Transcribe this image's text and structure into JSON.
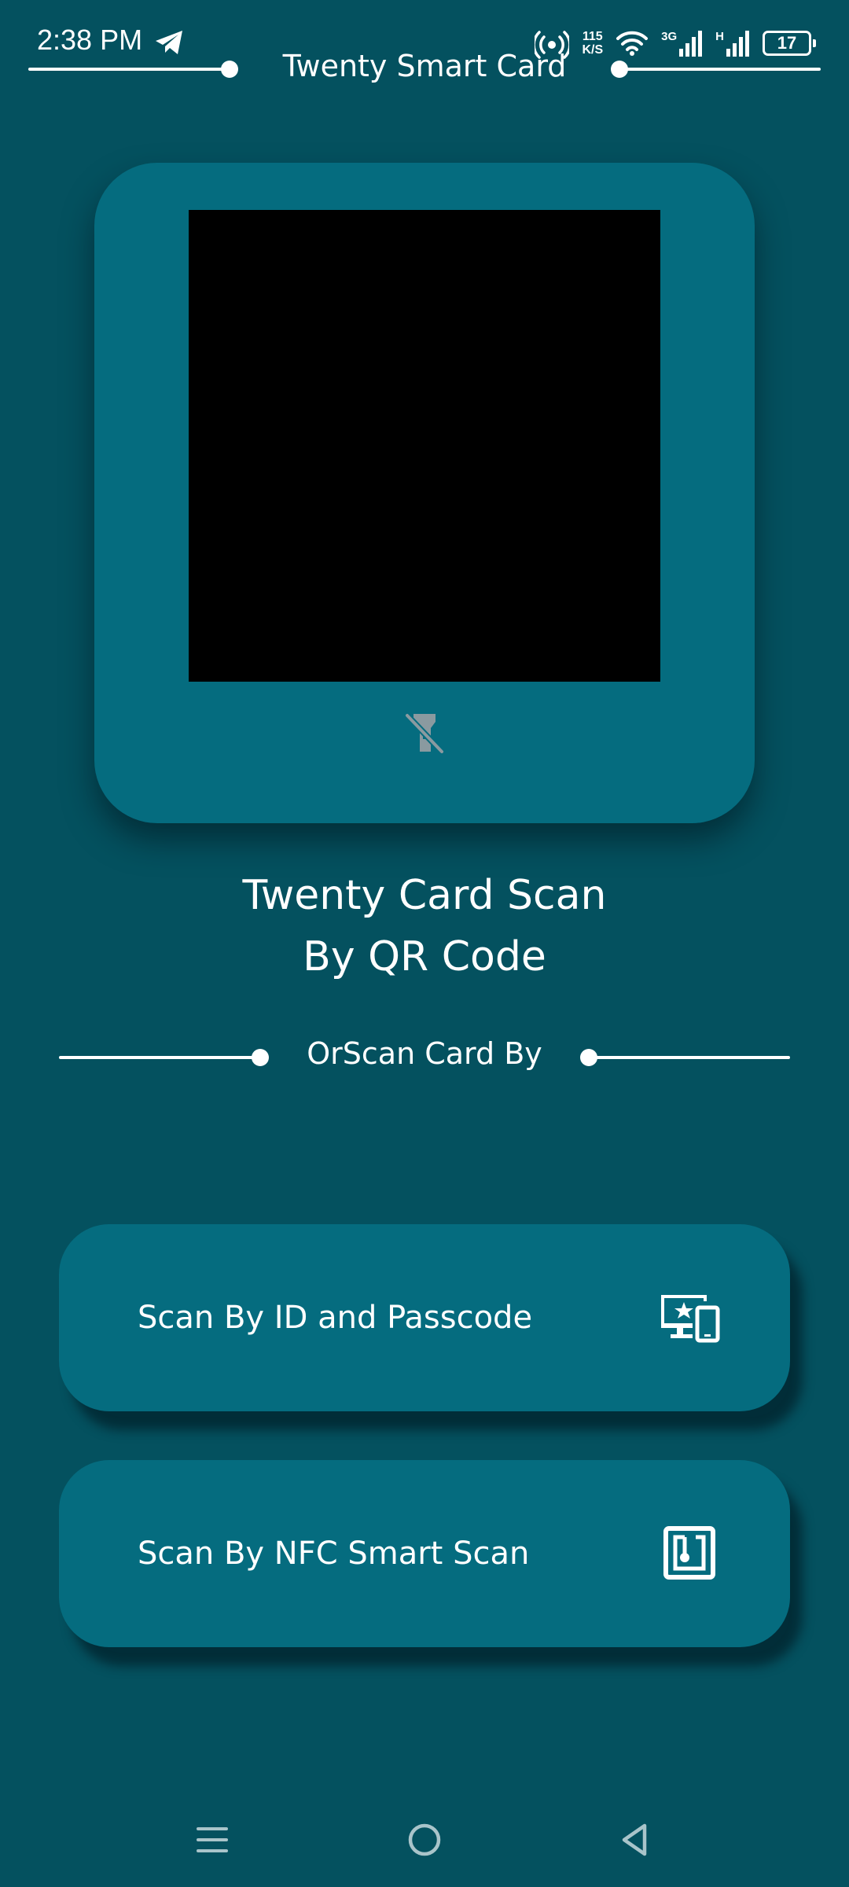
{
  "status_bar": {
    "time": "2:38 PM",
    "net_speed_value": "115",
    "net_speed_unit": "K/S",
    "network_3g": "3G",
    "network_h": "H",
    "battery": "17"
  },
  "header": {
    "title": "Twenty Smart Card"
  },
  "scanner": {
    "heading_line1": "Twenty Card Scan",
    "heading_line2": "By QR Code"
  },
  "divider": {
    "text": "OrScan Card By"
  },
  "options": [
    {
      "label": "Scan By ID and Passcode",
      "icon": "devices-star-icon"
    },
    {
      "label": "Scan By NFC Smart Scan",
      "icon": "nfc-icon"
    }
  ],
  "nav": {
    "items": [
      "menu-icon",
      "home-icon",
      "back-icon"
    ]
  },
  "colors": {
    "background": "#04515f",
    "card": "#056c7f",
    "camera": "#000000",
    "text": "#ffffff"
  }
}
